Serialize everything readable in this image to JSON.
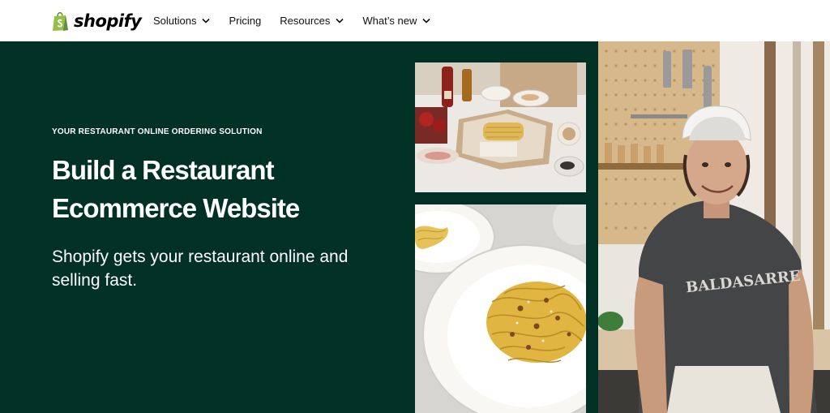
{
  "brand": {
    "name": "shopify",
    "logo_icon": "shopify-bag-icon",
    "color": "#95bf47"
  },
  "nav": {
    "items": [
      {
        "label": "Solutions",
        "has_dropdown": true
      },
      {
        "label": "Pricing",
        "has_dropdown": false
      },
      {
        "label": "Resources",
        "has_dropdown": true
      },
      {
        "label": "What’s new",
        "has_dropdown": true
      }
    ]
  },
  "hero": {
    "eyebrow": "YOUR RESTAURANT ONLINE ORDERING SOLUTION",
    "headline": "Build a Restaurant Ecommerce Website",
    "subhead": "Shopify gets your restaurant online and selling fast.",
    "background_color": "#003124"
  },
  "photos": {
    "chef_shirt_text": "BALDASARRE"
  }
}
